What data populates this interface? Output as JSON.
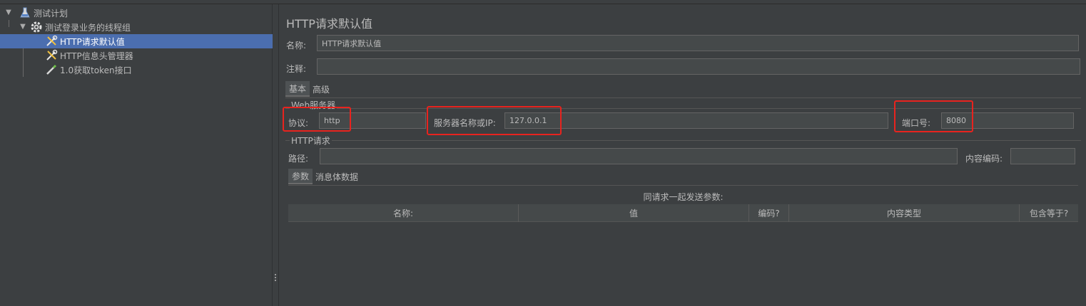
{
  "tree": {
    "items": [
      {
        "label": "测试计划",
        "icon": "flask-icon"
      },
      {
        "label": "测试登录业务的线程组",
        "icon": "gear-icon"
      },
      {
        "label": "HTTP请求默认值",
        "icon": "wrench-icon",
        "selected": true
      },
      {
        "label": "HTTP信息头管理器",
        "icon": "wrench-icon"
      },
      {
        "label": "1.0获取token接口",
        "icon": "pipette-icon"
      }
    ]
  },
  "panel": {
    "title": "HTTP请求默认值",
    "name_label": "名称:",
    "name_value": "HTTP请求默认值",
    "comment_label": "注释:",
    "comment_value": "",
    "tabs": [
      "基本",
      "高级"
    ],
    "web_server": {
      "group_title": "Web服务器",
      "protocol_label": "协议:",
      "protocol_value": "http",
      "server_label": "服务器名称或IP:",
      "server_value": "127.0.0.1",
      "port_label": "端口号:",
      "port_value": "8080"
    },
    "http_request": {
      "group_title": "HTTP请求",
      "path_label": "路径:",
      "path_value": "",
      "encoding_label": "内容编码:",
      "encoding_value": ""
    },
    "sub_tabs": [
      "参数",
      "消息体数据"
    ],
    "params_caption": "同请求一起发送参数:",
    "table_headers": [
      "名称:",
      "值",
      "编码?",
      "内容类型",
      "包含等于?"
    ]
  },
  "colors": {
    "selection": "#4b6eaf",
    "highlight_box": "#e8231e",
    "background": "#3c3f41"
  }
}
